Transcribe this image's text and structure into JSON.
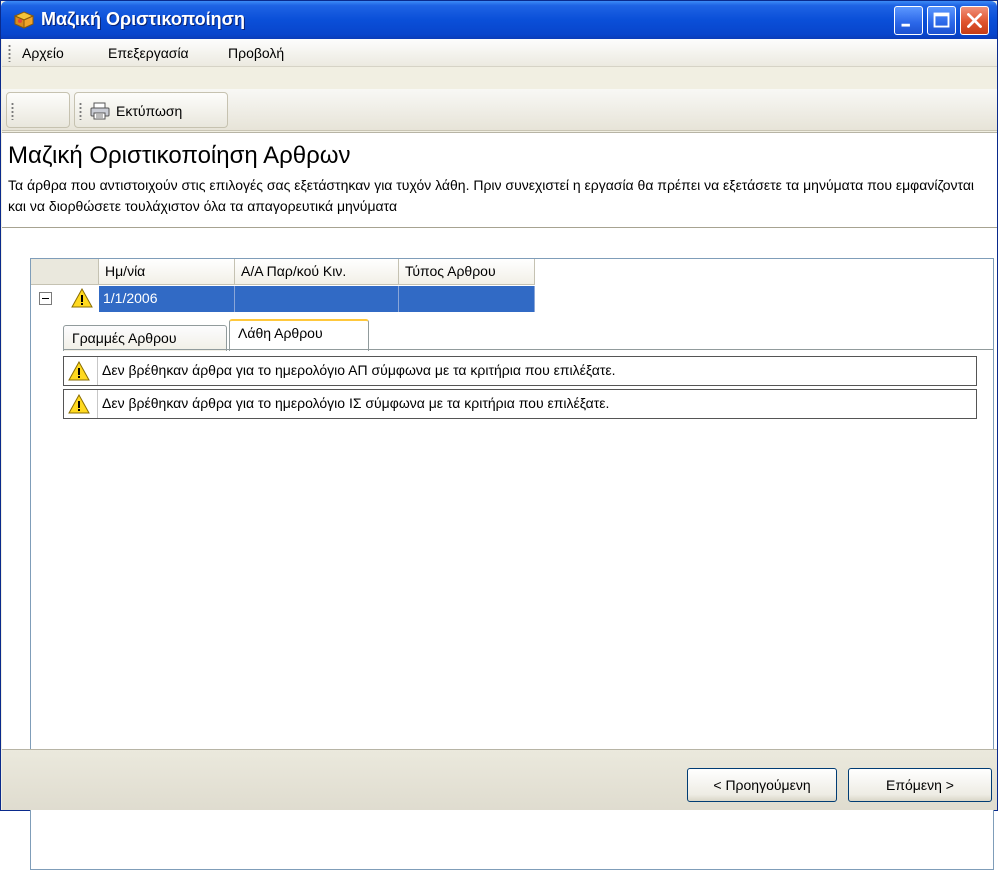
{
  "window": {
    "title": "Μαζική Οριστικοποίηση",
    "title_color": "#0a4fd8"
  },
  "menu": {
    "items": [
      {
        "label": "Αρχείο"
      },
      {
        "label": "Επεξεργασία"
      },
      {
        "label": "Προβολή"
      }
    ]
  },
  "toolbar": {
    "print_label": "Εκτύπωση"
  },
  "page": {
    "heading": "Μαζική Οριστικοποίηση Αρθρων",
    "description": "Τα άρθρα που αντιστοιχούν στις επιλογές σας εξετάστηκαν για τυχόν λάθη. Πριν συνεχιστεί η εργασία θα πρέπει να εξετάσετε τα μηνύματα που εμφανίζονται και να διορθώσετε τουλάχιστον όλα τα απαγορευτικά μηνύματα"
  },
  "grid": {
    "columns": [
      "Ημ/νία",
      "Α/Α Παρ/κού Κιν.",
      "Τύπος Αρθρου"
    ],
    "row": {
      "date": "1/1/2006",
      "doc_no": "",
      "type": ""
    },
    "selection_color": "#316ac5",
    "tabs": [
      {
        "label": "Γραμμές Αρθρου",
        "active": false
      },
      {
        "label": "Λάθη Αρθρου",
        "active": true
      }
    ],
    "errors": [
      {
        "icon": "warning-icon",
        "text": "Δεν βρέθηκαν άρθρα για το ημερολόγιο ΑΠ σύμφωνα με τα κριτήρια που επιλέξατε."
      },
      {
        "icon": "warning-icon",
        "text": "Δεν βρέθηκαν άρθρα για το ημερολόγιο ΙΣ σύμφωνα με τα κριτήρια που επιλέξατε."
      }
    ]
  },
  "footer": {
    "prev_label": "< Προηγούμενη",
    "next_label": "Επόμενη >"
  }
}
